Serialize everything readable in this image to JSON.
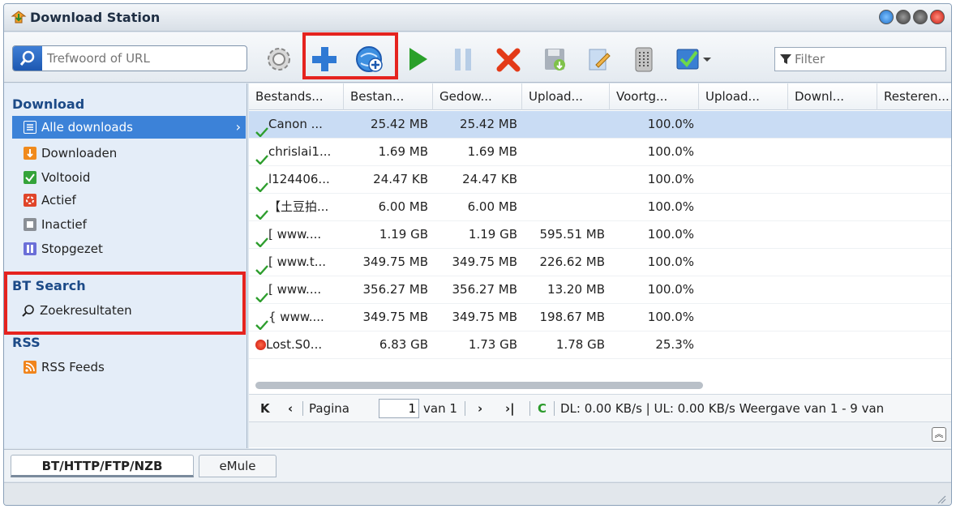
{
  "window": {
    "title": "Download Station"
  },
  "toolbar": {
    "search_placeholder": "Trefwoord of URL",
    "filter_placeholder": "Filter",
    "buttons": [
      "settings-icon",
      "add-icon",
      "add-url-icon",
      "start-icon",
      "pause-icon",
      "delete-icon",
      "save-icon",
      "edit-icon",
      "clear-icon",
      "select-icon"
    ],
    "highlight_color": "#e5231f"
  },
  "sidebar": {
    "download_title": "Download",
    "download_items": [
      {
        "label": "Alle downloads",
        "icon": "list-icon"
      },
      {
        "label": "Downloaden",
        "icon": "downloading-icon"
      },
      {
        "label": "Voltooid",
        "icon": "completed-icon"
      },
      {
        "label": "Actief",
        "icon": "active-icon"
      },
      {
        "label": "Inactief",
        "icon": "inactive-icon"
      },
      {
        "label": "Stopgezet",
        "icon": "stopped-icon"
      }
    ],
    "bt_title": "BT Search",
    "bt_item": "Zoekresultaten",
    "rss_title": "RSS",
    "rss_item": "RSS Feeds",
    "selected_color": "#3c82d8"
  },
  "grid": {
    "columns": [
      "Bestands...",
      "Bestan...",
      "Gedow...",
      "Upload...",
      "Voortg...",
      "Upload...",
      "Downl...",
      "Resteren..."
    ],
    "rows": [
      {
        "name": "Canon ...",
        "size": "25.42 MB",
        "downloaded": "25.42 MB",
        "uploaded": "",
        "progress": "100.0%",
        "status": "check"
      },
      {
        "name": "chrislai1...",
        "size": "1.69 MB",
        "downloaded": "1.69 MB",
        "uploaded": "",
        "progress": "100.0%",
        "status": "check"
      },
      {
        "name": "l124406...",
        "size": "24.47 KB",
        "downloaded": "24.47 KB",
        "uploaded": "",
        "progress": "100.0%",
        "status": "check"
      },
      {
        "name": "【土豆拍...",
        "size": "6.00 MB",
        "downloaded": "6.00 MB",
        "uploaded": "",
        "progress": "100.0%",
        "status": "check"
      },
      {
        "name": "[ www....",
        "size": "1.19 GB",
        "downloaded": "1.19 GB",
        "uploaded": "595.51 MB",
        "progress": "100.0%",
        "status": "check"
      },
      {
        "name": "[ www.t...",
        "size": "349.75 MB",
        "downloaded": "349.75 MB",
        "uploaded": "226.62 MB",
        "progress": "100.0%",
        "status": "check"
      },
      {
        "name": "[ www....",
        "size": "356.27 MB",
        "downloaded": "356.27 MB",
        "uploaded": "13.20 MB",
        "progress": "100.0%",
        "status": "check"
      },
      {
        "name": "{ www....",
        "size": "349.75 MB",
        "downloaded": "349.75 MB",
        "uploaded": "198.67 MB",
        "progress": "100.0%",
        "status": "check"
      },
      {
        "name": "Lost.S0...",
        "size": "6.83 GB",
        "downloaded": "1.73 GB",
        "uploaded": "1.78 GB",
        "progress": "25.3%",
        "status": "error"
      }
    ]
  },
  "pager": {
    "page_label": "Pagina",
    "page_value": "1",
    "of_label": "van 1",
    "status": "DL: 0.00 KB/s | UL: 0.00 KB/s Weergave van 1 - 9 van"
  },
  "tabs": [
    "BT/HTTP/FTP/NZB",
    "eMule"
  ]
}
